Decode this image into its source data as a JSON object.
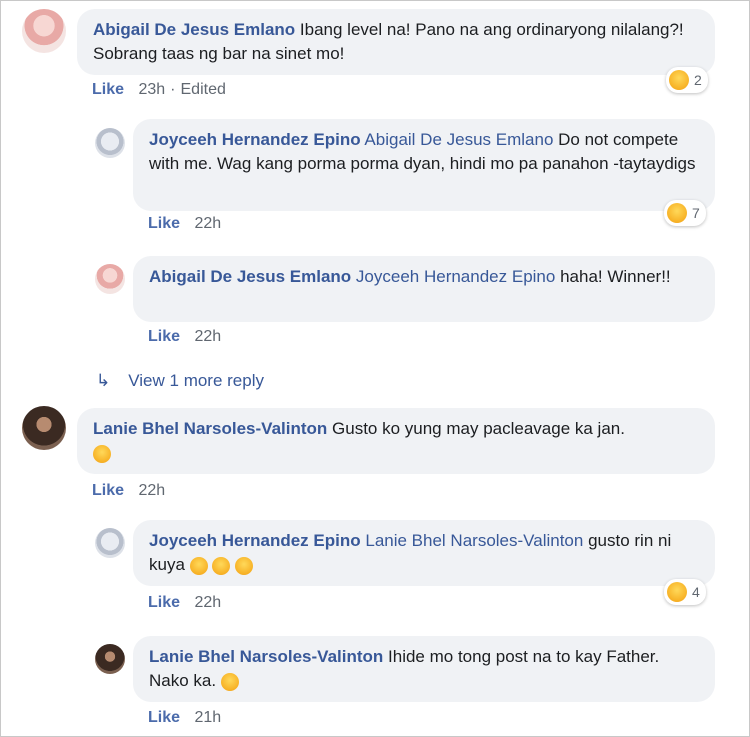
{
  "comments": [
    {
      "author": "Abigail De Jesus Emlano",
      "mention": "",
      "text": "Ibang level na! Pano na ang ordinaryong nilalang?! Sobrang taas ng bar na sinet mo!",
      "like": "Like",
      "time": "23h",
      "edited": "Edited",
      "reaction_count": "2"
    },
    {
      "author": "Joyceeh Hernandez Epino",
      "mention": "Abigail De Jesus Emlano",
      "text": "Do not compete with me. Wag kang porma porma dyan, hindi mo pa panahon -taytaydigs",
      "like": "Like",
      "time": "22h",
      "reaction_count": "7"
    },
    {
      "author": "Abigail De Jesus Emlano",
      "mention": "Joyceeh Hernandez Epino",
      "text": "haha! Winner!!",
      "like": "Like",
      "time": "22h"
    },
    {
      "author": "Lanie Bhel Narsoles-Valinton",
      "mention": "",
      "text": "Gusto ko yung may pacleavage ka jan.",
      "like": "Like",
      "time": "22h"
    },
    {
      "author": "Joyceeh Hernandez Epino",
      "mention": "Lanie Bhel Narsoles-Valinton",
      "text": "gusto rin ni kuya",
      "like": "Like",
      "time": "22h",
      "reaction_count": "4"
    },
    {
      "author": "Lanie Bhel Narsoles-Valinton",
      "mention": "",
      "text": "Ihide mo tong post na to kay Father. Nako ka.",
      "like": "Like",
      "time": "21h"
    }
  ],
  "view_more": "View 1 more reply",
  "colors": {
    "link": "#385898",
    "bubble": "#f0f2f5",
    "meta": "#606770"
  }
}
